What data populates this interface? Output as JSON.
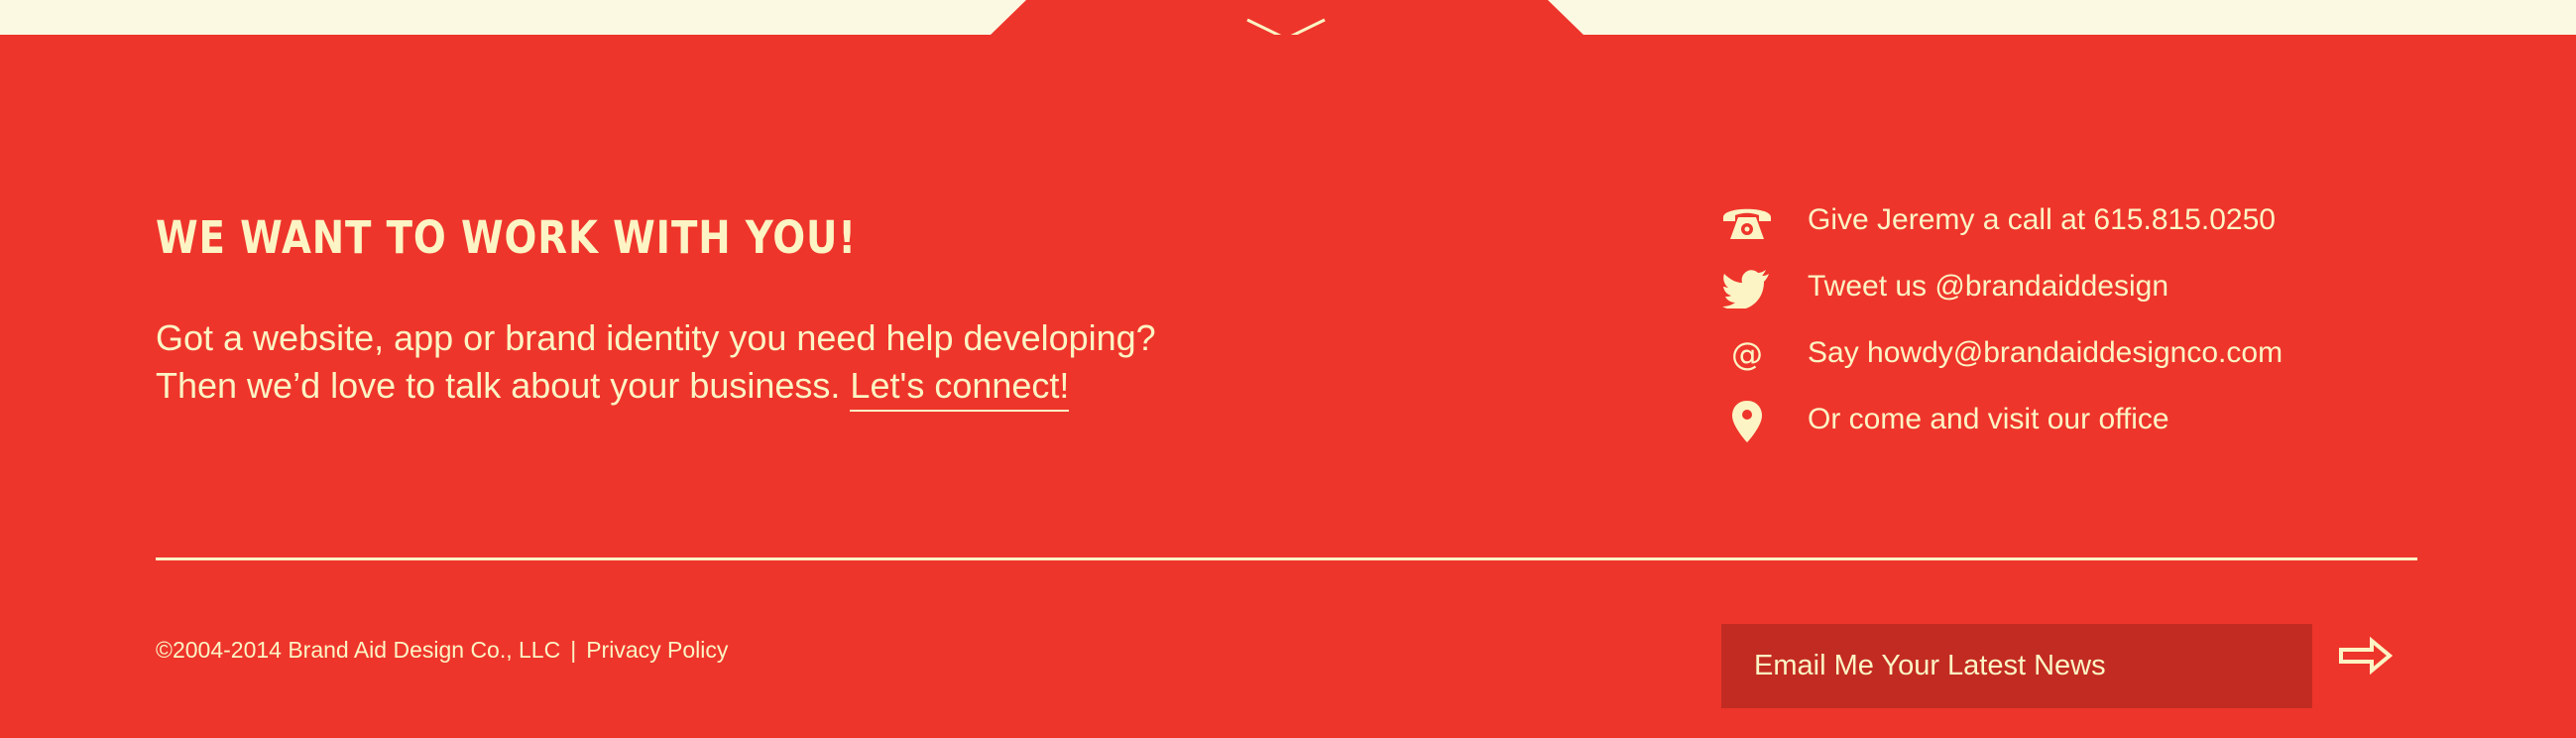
{
  "colors": {
    "background": "#FCF9E3",
    "footer": "#EE352B",
    "text": "#FCF4C4",
    "input_background": "#C22B22"
  },
  "footer": {
    "heading": "WE WANT TO WORK WITH YOU!",
    "intro_line1": "Got a website, app or brand identity you need help developing?",
    "intro_line2": "Then we’d love to talk about your business.",
    "connect_link": "Let's connect!",
    "contacts": [
      {
        "icon": "phone-icon",
        "text": "Give Jeremy a call at 615.815.0250"
      },
      {
        "icon": "twitter-bird-icon",
        "text": "Tweet us @brandaiddesign"
      },
      {
        "icon": "at-sign-icon",
        "text": "Say howdy@brandaiddesignco.com"
      },
      {
        "icon": "map-pin-icon",
        "text": "Or come and visit our office"
      }
    ],
    "copyright": "©2004-2014 Brand Aid Design Co., LLC",
    "separator": "|",
    "privacy_link": "Privacy Policy",
    "newsletter_placeholder": "Email Me Your Latest News"
  }
}
